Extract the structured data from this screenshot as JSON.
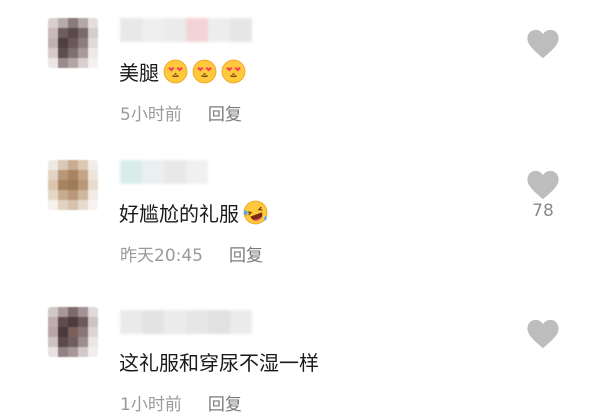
{
  "comments": [
    {
      "text": "美腿",
      "time": "5小时前",
      "reply_label": "回复",
      "like_count": "",
      "emojis": [
        "heart-eyes-emoji",
        "heart-eyes-emoji",
        "heart-eyes-emoji"
      ]
    },
    {
      "text": "好尴尬的礼服",
      "time": "昨天20:45",
      "reply_label": "回复",
      "like_count": "78",
      "emojis": [
        "laughing-crying-emoji"
      ]
    },
    {
      "text": "这礼服和穿尿不湿一样",
      "time": "1小时前",
      "reply_label": "回复",
      "like_count": "",
      "emojis": []
    }
  ],
  "icons": {
    "like": "heart-icon"
  },
  "colors": {
    "heart": "#bdbdbd",
    "meta_text": "#9a9a9a",
    "body_text": "#1a1a1a"
  }
}
